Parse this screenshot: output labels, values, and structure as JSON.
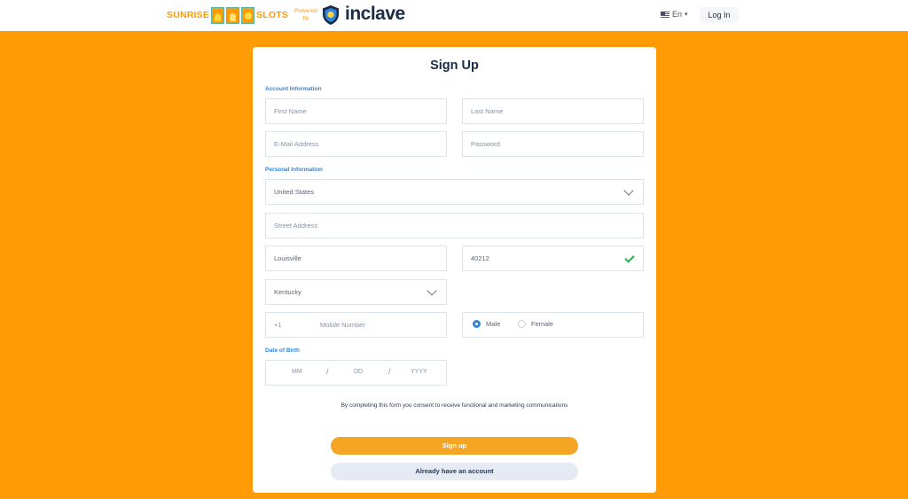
{
  "header": {
    "brand_left": "SUNRISE",
    "brand_right": "SLOTS",
    "powered_line1": "Powered",
    "powered_line2": "by",
    "partner_name": "inclave",
    "language": "En",
    "login_label": "Log In"
  },
  "form": {
    "title": "Sign Up",
    "account_section": "Account Information",
    "personal_section": "Personal Information",
    "dob_section": "Date of Birth",
    "first_name_placeholder": "First Name",
    "last_name_placeholder": "Last Name",
    "email_placeholder": "E-Mail Address",
    "password_placeholder": "Password",
    "country_value": "United States",
    "street_placeholder": "Street Address",
    "city_value": "Louisville",
    "zip_value": "40212",
    "state_value": "Kentucky",
    "phone_code": "+1",
    "mobile_placeholder": "Mobile Number",
    "gender_options": [
      "Male",
      "Female"
    ],
    "gender_selected": "Male",
    "dob_month_placeholder": "MM",
    "dob_day_placeholder": "DD",
    "dob_year_placeholder": "YYYY",
    "dob_separator": "/",
    "consent_text": "By completing this form you consent to receive functional and marketing communications",
    "signup_label": "Sign up",
    "existing_account_label": "Already have an account"
  },
  "colors": {
    "page_background": "#ff9c05",
    "primary_button": "#f5a524",
    "section_label": "#2f86d9",
    "valid_check": "#27b04a"
  }
}
